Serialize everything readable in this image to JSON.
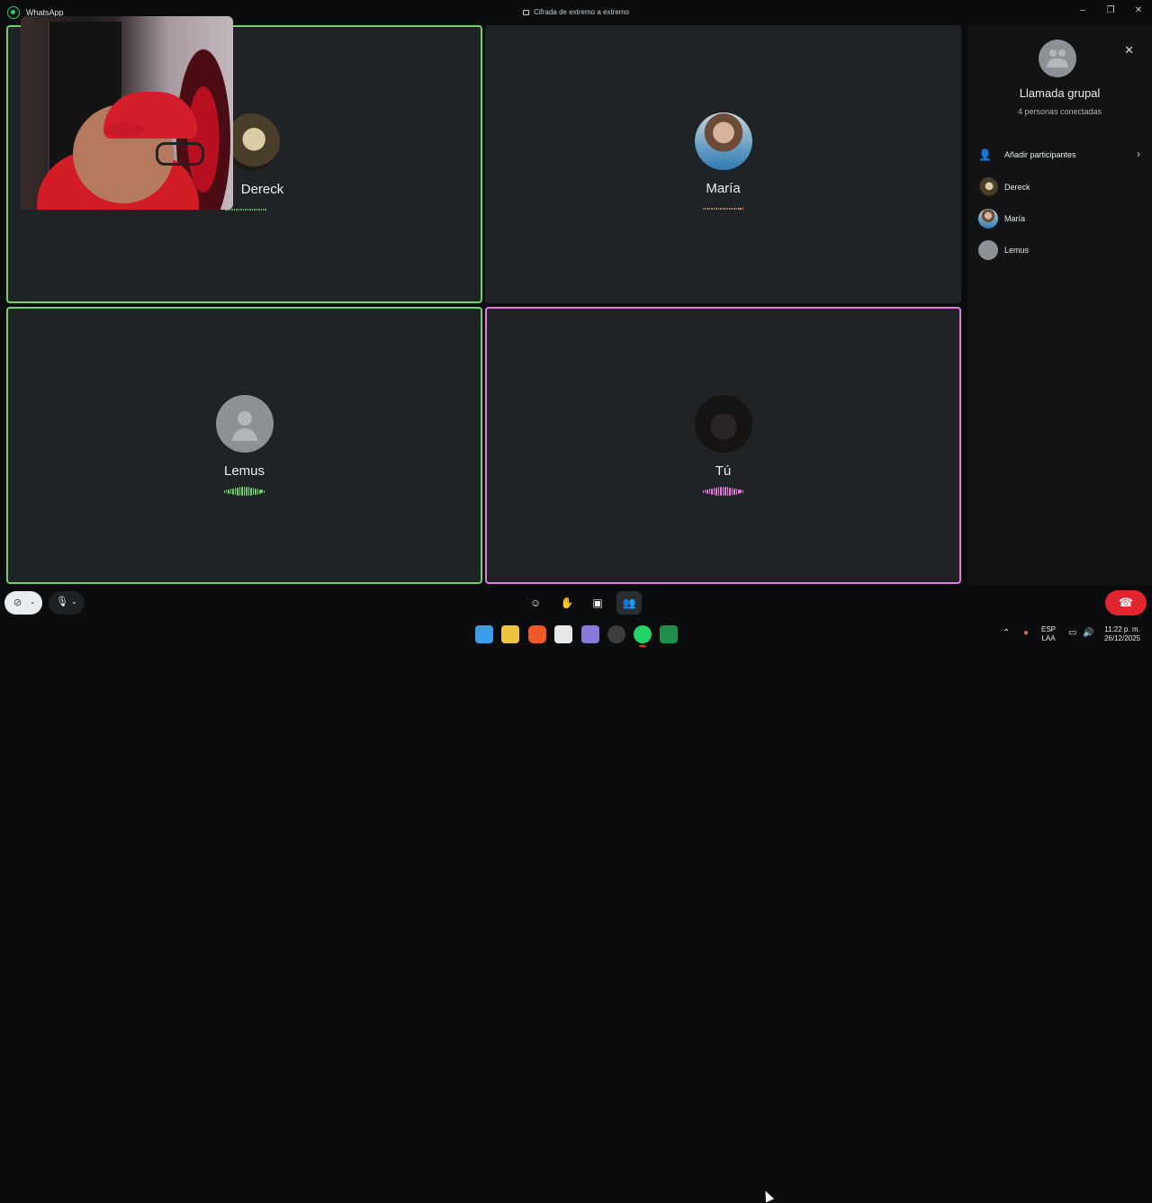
{
  "window": {
    "app_title": "WhatsApp",
    "encryption_text": "Cifrada de extremo a extremo",
    "controls": [
      "–",
      "❐",
      "✕"
    ]
  },
  "tiles": [
    {
      "name": "Dereck",
      "state": "speaking",
      "border": "#6ed36b"
    },
    {
      "name": "María",
      "state": "idle"
    },
    {
      "name": "Lemus",
      "state": "speaking",
      "border": "#6ed36b"
    },
    {
      "name": "Tú",
      "state": "speaking",
      "border": "#e67adf"
    }
  ],
  "panel": {
    "title": "Llamada grupal",
    "subtitle": "4 personas conectadas",
    "add_label": "Añadir participantes",
    "participants": [
      "Dereck",
      "María",
      "Lemus"
    ]
  },
  "controls": {
    "camera_icon": "video-off-icon",
    "mic_icon": "mic-icon",
    "emoji_icon": "emoji-icon",
    "raise_hand_icon": "hand-icon",
    "share_icon": "screen-share-icon",
    "participants_icon": "people-icon",
    "hangup_icon": "phone-hangup-icon"
  },
  "taskbar": {
    "lang_top": "ESP",
    "lang_bottom": "LAA",
    "time": "11:22 p. m.",
    "date": "26/12/2025"
  },
  "colors": {
    "speaking_green": "#6ed36b",
    "self_pink": "#e67adf",
    "hangup_red": "#e2262f",
    "brand": "#25d366"
  }
}
